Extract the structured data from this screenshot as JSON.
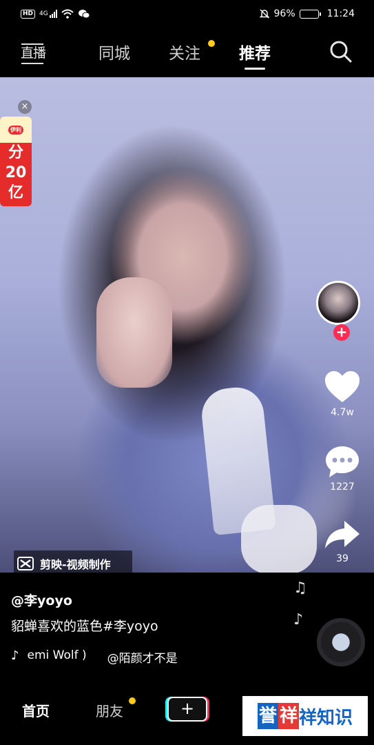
{
  "status_bar": {
    "network": "HD",
    "network_type": "4G",
    "battery": "96%",
    "battery_level": 0.96,
    "time": "11:24"
  },
  "top_nav": {
    "live_label": "直播",
    "tabs": [
      {
        "label": "同城",
        "active": false
      },
      {
        "label": "关注",
        "active": false,
        "dot": true
      },
      {
        "label": "推荐",
        "active": true
      }
    ]
  },
  "ad": {
    "close": "×",
    "text_line1": "分",
    "text_line2": "20",
    "text_line3": "亿"
  },
  "actions": {
    "follow_plus": "+",
    "likes": "4.7w",
    "comments": "1227",
    "shares": "39"
  },
  "watermark": {
    "label": "剪映-视频制作"
  },
  "video_info": {
    "author": "@李yoyo",
    "caption": "貂蝉喜欢的蓝色#李yoyo",
    "music_scroll": "emi Wolf )",
    "music_owner": "@陌颜才不是"
  },
  "bottom_nav": {
    "home": "首页",
    "friends": "朋友",
    "plus": "+"
  },
  "brand_badge": {
    "char1": "誉",
    "char2": "祥",
    "rest": "祥知识"
  },
  "colors": {
    "accent_red": "#fe2c55",
    "notify_dot": "#ffcc1a",
    "teal": "#25f4ee"
  }
}
